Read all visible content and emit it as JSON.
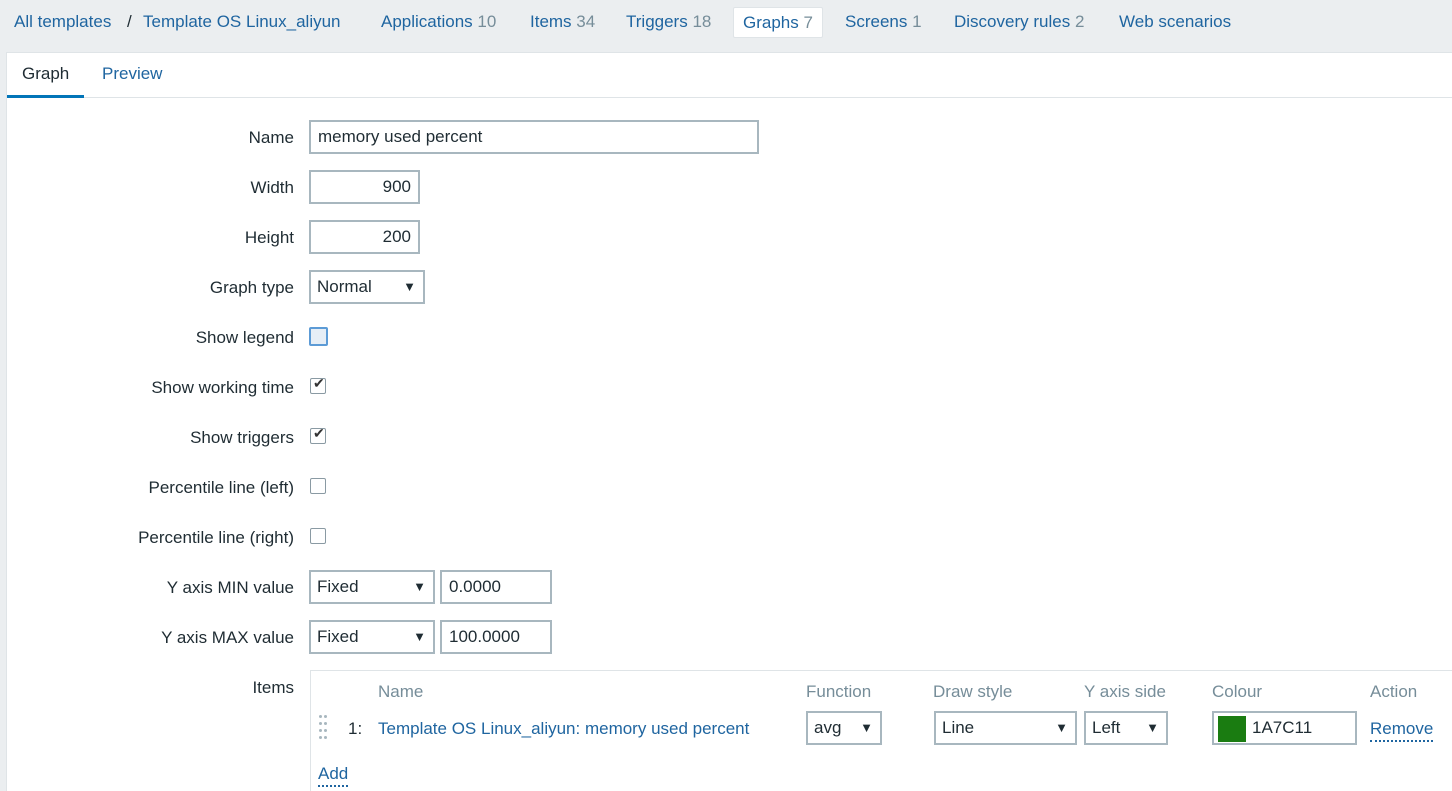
{
  "breadcrumbs": {
    "all_templates": "All templates",
    "separator": "/",
    "template_name": "Template OS Linux_aliyun",
    "tabs": [
      {
        "label": "Applications",
        "count": "10"
      },
      {
        "label": "Items",
        "count": "34"
      },
      {
        "label": "Triggers",
        "count": "18"
      },
      {
        "label": "Graphs",
        "count": "7"
      },
      {
        "label": "Screens",
        "count": "1"
      },
      {
        "label": "Discovery rules",
        "count": "2"
      },
      {
        "label": "Web scenarios",
        "count": ""
      }
    ]
  },
  "form_tabs": {
    "graph": "Graph",
    "preview": "Preview"
  },
  "form": {
    "name_label": "Name",
    "name_value": "memory used percent",
    "width_label": "Width",
    "width_value": "900",
    "height_label": "Height",
    "height_value": "200",
    "graph_type_label": "Graph type",
    "graph_type_value": "Normal",
    "show_legend_label": "Show legend",
    "show_legend_checked": false,
    "show_working_time_label": "Show working time",
    "show_working_time_checked": true,
    "show_triggers_label": "Show triggers",
    "show_triggers_checked": true,
    "percentile_left_label": "Percentile line (left)",
    "percentile_left_checked": false,
    "percentile_right_label": "Percentile line (right)",
    "percentile_right_checked": false,
    "ymin_label": "Y axis MIN value",
    "ymin_type": "Fixed",
    "ymin_value": "0.0000",
    "ymax_label": "Y axis MAX value",
    "ymax_type": "Fixed",
    "ymax_value": "100.0000",
    "items_label": "Items"
  },
  "items_table": {
    "headers": {
      "name": "Name",
      "function": "Function",
      "draw_style": "Draw style",
      "y_axis_side": "Y axis side",
      "colour": "Colour",
      "action": "Action"
    },
    "rows": [
      {
        "index": "1:",
        "name": "Template OS Linux_aliyun: memory used percent",
        "function": "avg",
        "draw_style": "Line",
        "y_axis_side": "Left",
        "colour": "1A7C11",
        "action": "Remove"
      }
    ],
    "add_label": "Add"
  },
  "icons": {
    "dropdown": "chevron-down-icon",
    "checkmark": "check-icon",
    "drag": "drag-handle-icon"
  }
}
